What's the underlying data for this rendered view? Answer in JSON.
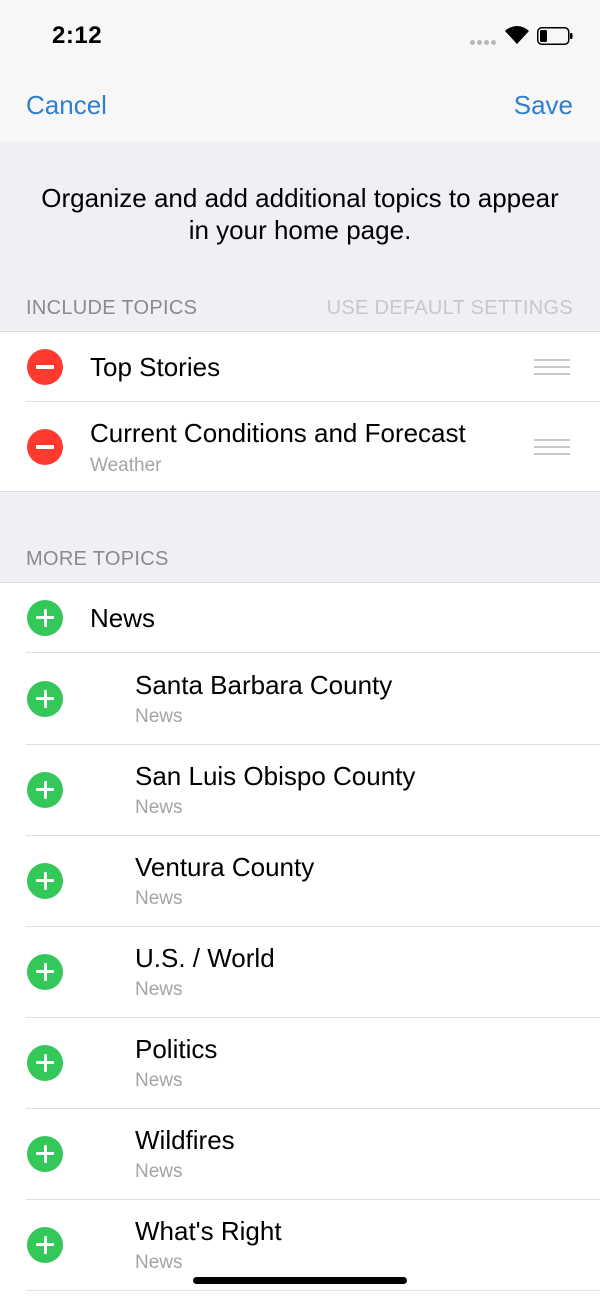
{
  "status_bar": {
    "time": "2:12",
    "wifi_icon": "wifi-icon",
    "battery_icon": "battery-icon"
  },
  "nav": {
    "cancel_label": "Cancel",
    "save_label": "Save",
    "accent_color": "#2f7ecf"
  },
  "intro_text": "Organize and add additional topics to appear in your home page.",
  "include_section": {
    "header": "INCLUDE TOPICS",
    "default_link": "USE DEFAULT SETTINGS",
    "items": [
      {
        "title": "Top Stories",
        "subtitle": ""
      },
      {
        "title": "Current Conditions and Forecast",
        "subtitle": "Weather"
      }
    ]
  },
  "more_section": {
    "header": "MORE TOPICS",
    "items": [
      {
        "title": "News",
        "subtitle": ""
      },
      {
        "title": "Santa Barbara County",
        "subtitle": "News"
      },
      {
        "title": "San Luis Obispo County",
        "subtitle": "News"
      },
      {
        "title": "Ventura County",
        "subtitle": "News"
      },
      {
        "title": "U.S. / World",
        "subtitle": "News"
      },
      {
        "title": "Politics",
        "subtitle": "News"
      },
      {
        "title": "Wildfires",
        "subtitle": "News"
      },
      {
        "title": "What's Right",
        "subtitle": "News"
      }
    ]
  },
  "colors": {
    "remove": "#ff3b30",
    "add": "#34c759"
  }
}
